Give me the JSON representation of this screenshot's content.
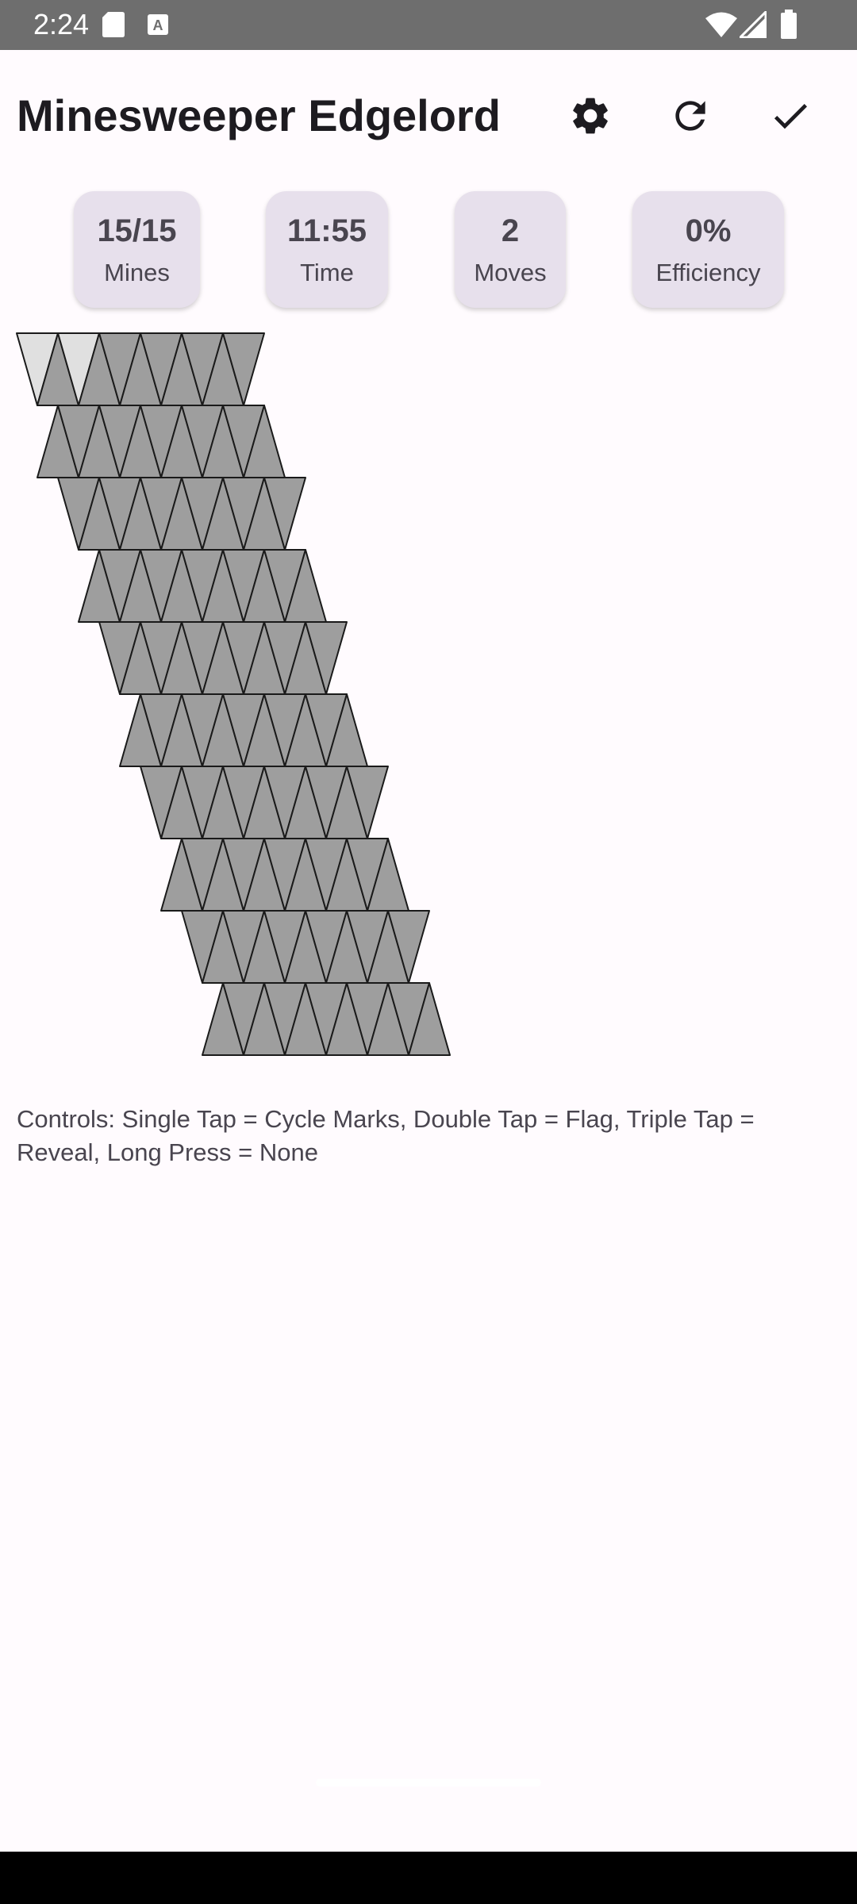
{
  "status_bar": {
    "time": "2:24",
    "icons_left": [
      "sd-card-icon",
      "keyboard-a-icon"
    ],
    "icons_right": [
      "wifi-icon",
      "signal-icon",
      "battery-icon"
    ]
  },
  "app_bar": {
    "title": "Minesweeper Edgelord",
    "actions": [
      "settings-icon",
      "refresh-icon",
      "check-icon"
    ]
  },
  "stats": [
    {
      "value": "15/15",
      "label": "Mines"
    },
    {
      "value": "11:55",
      "label": "Time"
    },
    {
      "value": "2",
      "label": "Moves"
    },
    {
      "value": "0%",
      "label": "Efficiency"
    }
  ],
  "board": {
    "rows": 10,
    "cols": 11,
    "revealed_cells": [
      [
        0,
        0
      ],
      [
        0,
        2
      ]
    ],
    "colors": {
      "hidden": "#9e9e9e",
      "revealed": "#e0e0e0",
      "stroke": "#1a1a1a"
    }
  },
  "controls_text": "Controls: Single Tap = Cycle Marks, Double Tap = Flag, Triple Tap = Reveal, Long Press = None",
  "colors": {
    "background": "#fffbfe",
    "status_bar": "#6e6e6e",
    "stat_card": "#e7e0ec",
    "nav_bar": "#000000"
  }
}
